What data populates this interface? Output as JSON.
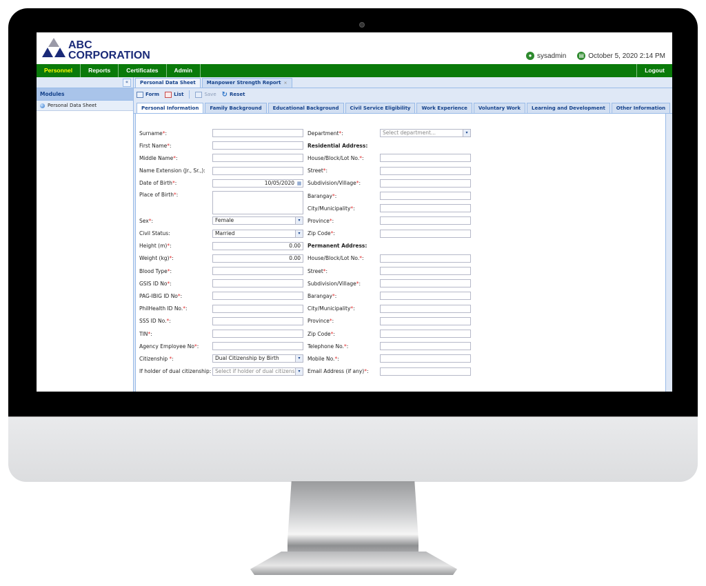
{
  "brand": {
    "line1": "ABC",
    "line2": "CORPORATION",
    "color": "#1a2a78"
  },
  "user": {
    "icon": "user-icon",
    "name": "sysadmin",
    "date_icon": "calendar-icon",
    "datetime": "October 5, 2020 2:14 PM"
  },
  "nav": {
    "items": [
      "Personnel",
      "Reports",
      "Certificates",
      "Admin"
    ],
    "active": "Personnel",
    "logout": "Logout",
    "color": "#0a7a0a"
  },
  "sidebar": {
    "collapse": "«",
    "header": "Modules",
    "items": [
      {
        "label": "Personal Data Sheet",
        "icon": "module-dot-icon"
      }
    ]
  },
  "doc_tabs": [
    {
      "label": "Personal Data Sheet",
      "active": true
    },
    {
      "label": "Manpower Strength Report",
      "closable": true,
      "close": "×"
    }
  ],
  "toolbar": {
    "form": "Form",
    "list": "List",
    "save": "Save",
    "reset": "Reset"
  },
  "form_tabs": [
    "Personal Information",
    "Family Background",
    "Educational Background",
    "Civil Service Eligibility",
    "Work Experience",
    "Voluntary Work",
    "Learning and Development",
    "Other Information"
  ],
  "left_fields": [
    {
      "label": "Surname",
      "req": true,
      "value": ""
    },
    {
      "label": "First Name",
      "req": true,
      "value": ""
    },
    {
      "label": "Middle Name",
      "req": true,
      "value": ""
    },
    {
      "label": "Name Extension (Jr., Sr.,):",
      "req": false,
      "value": ""
    },
    {
      "label": "Date of Birth",
      "req": true,
      "value": "10/05/2020"
    },
    {
      "label": "Place of Birth",
      "req": true,
      "value": ""
    },
    {
      "label": "Sex",
      "req": true,
      "value": "Female"
    },
    {
      "label": "Civil Status:",
      "req": false,
      "value": "Married"
    },
    {
      "label": "Height (m)",
      "req": true,
      "value": "0.00"
    },
    {
      "label": "Weight (kg)",
      "req": true,
      "value": "0.00"
    },
    {
      "label": "Blood Type",
      "req": true,
      "value": ""
    },
    {
      "label": "GSIS ID No",
      "req": true,
      "value": ""
    },
    {
      "label": "PAG-IBIG ID No",
      "req": true,
      "value": ""
    },
    {
      "label": "PhilHealth ID No.",
      "req": true,
      "value": ""
    },
    {
      "label": "SSS ID No.",
      "req": true,
      "value": ""
    },
    {
      "label": "TIN",
      "req": true,
      "value": ""
    },
    {
      "label": "Agency Employee No",
      "req": true,
      "value": ""
    },
    {
      "label": "Citizenship ",
      "req": true,
      "value": "Dual Citizenship by Birth"
    },
    {
      "label": "If holder of dual citizenship:",
      "req": false,
      "placeholder": "Select if holder of dual citizenship..."
    }
  ],
  "right_fields": [
    {
      "label": "Department",
      "req": true,
      "placeholder": "Select department..."
    },
    {
      "section": "Residential Address:"
    },
    {
      "label": "House/Block/Lot No.",
      "req": true,
      "value": ""
    },
    {
      "label": "Street",
      "req": true,
      "value": ""
    },
    {
      "label": "Subdivision/Village",
      "req": true,
      "value": ""
    },
    {
      "label": "Barangay",
      "req": true,
      "value": ""
    },
    {
      "label": "City/Municipality",
      "req": true,
      "value": ""
    },
    {
      "label": "Province",
      "req": true,
      "value": ""
    },
    {
      "label": "Zip Code",
      "req": true,
      "value": ""
    },
    {
      "section": "Permanent Address:"
    },
    {
      "label": "House/Block/Lot No.",
      "req": true,
      "value": ""
    },
    {
      "label": "Street",
      "req": true,
      "value": ""
    },
    {
      "label": "Subdivision/Village",
      "req": true,
      "value": ""
    },
    {
      "label": "Barangay",
      "req": true,
      "value": ""
    },
    {
      "label": "City/Municipality",
      "req": true,
      "value": ""
    },
    {
      "label": "Province",
      "req": true,
      "value": ""
    },
    {
      "label": "Zip Code",
      "req": true,
      "value": ""
    },
    {
      "label": "Telephone No.",
      "req": true,
      "value": ""
    },
    {
      "label": "Mobile No.",
      "req": true,
      "value": ""
    },
    {
      "label": "Email Address (if any)",
      "req": true,
      "value": ""
    }
  ],
  "required_mark": "*",
  "colon": ":"
}
